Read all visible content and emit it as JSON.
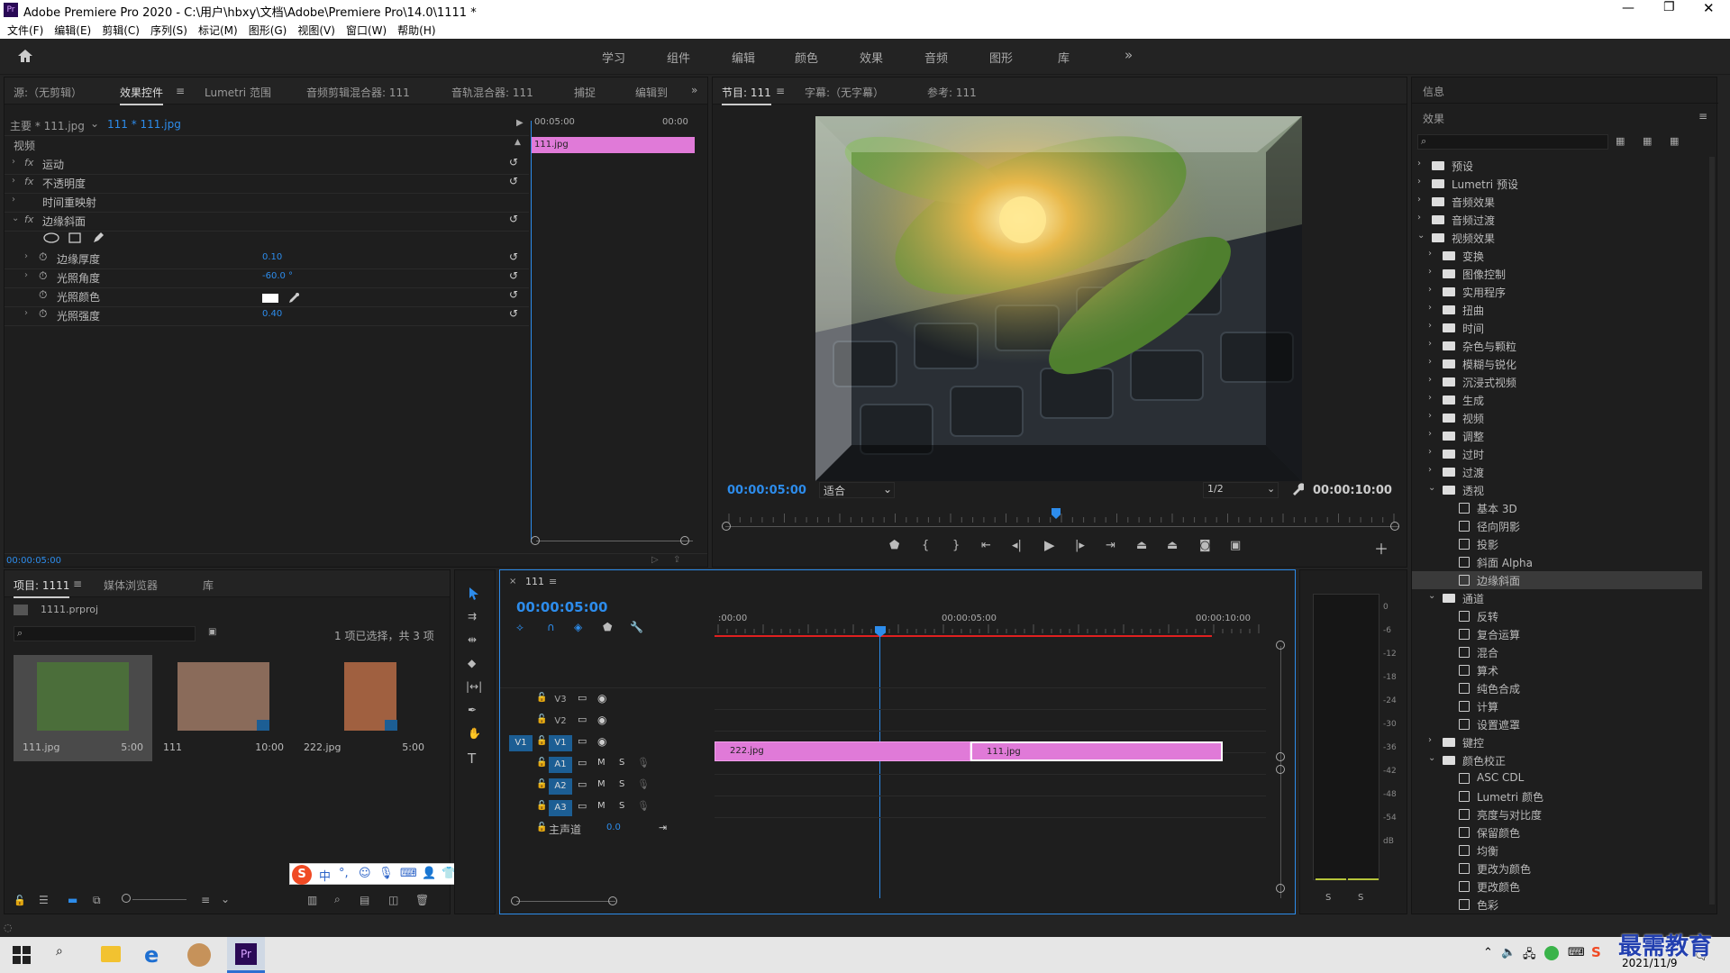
{
  "window": {
    "title": "Adobe Premiere Pro 2020 - C:\\用户\\hbxy\\文档\\Adobe\\Premiere Pro\\14.0\\1111 *"
  },
  "menu": [
    "文件(F)",
    "编辑(E)",
    "剪辑(C)",
    "序列(S)",
    "标记(M)",
    "图形(G)",
    "视图(V)",
    "窗口(W)",
    "帮助(H)"
  ],
  "workspaces": [
    "学习",
    "组件",
    "编辑",
    "颜色",
    "效果",
    "音频",
    "图形",
    "库"
  ],
  "source_panel": {
    "tabs": [
      "源:（无剪辑）",
      "效果控件",
      "Lumetri 范围",
      "音频剪辑混合器: 111",
      "音轨混合器: 111",
      "捕捉",
      "编辑到"
    ],
    "master": "主要 * 111.jpg",
    "clip": "111 * 111.jpg",
    "ruler_start": "00:05:00",
    "ruler_end": "00:00",
    "clip_bar": "111.jpg",
    "section": "视频",
    "effects": [
      {
        "name": "运动",
        "fx": "fx"
      },
      {
        "name": "不透明度",
        "fx": "fx"
      },
      {
        "name": "时间重映射",
        "fx": ""
      },
      {
        "name": "边缘斜面",
        "fx": "fx"
      }
    ],
    "params": [
      {
        "name": "边缘厚度",
        "value": "0.10"
      },
      {
        "name": "光照角度",
        "value": "-60.0 °"
      },
      {
        "name": "光照颜色",
        "value": ""
      },
      {
        "name": "光照强度",
        "value": "0.40"
      }
    ],
    "timecode": "00:00:05:00"
  },
  "program_panel": {
    "tabs": [
      "节目: 111",
      "字幕:（无字幕）",
      "参考: 111"
    ],
    "timecode_left": "00:00:05:00",
    "fit": "适合",
    "resolution": "1/2",
    "timecode_right": "00:00:10:00"
  },
  "right_panel": {
    "info_tab": "信息",
    "effects_tab": "效果",
    "tree": [
      {
        "label": "预设",
        "depth": 0,
        "type": "folder",
        "exp": false
      },
      {
        "label": "Lumetri 预设",
        "depth": 0,
        "type": "folder",
        "exp": false
      },
      {
        "label": "音频效果",
        "depth": 0,
        "type": "folder",
        "exp": false
      },
      {
        "label": "音频过渡",
        "depth": 0,
        "type": "folder",
        "exp": false
      },
      {
        "label": "视频效果",
        "depth": 0,
        "type": "folder",
        "exp": true
      },
      {
        "label": "变换",
        "depth": 1,
        "type": "folder",
        "exp": false
      },
      {
        "label": "图像控制",
        "depth": 1,
        "type": "folder",
        "exp": false
      },
      {
        "label": "实用程序",
        "depth": 1,
        "type": "folder",
        "exp": false
      },
      {
        "label": "扭曲",
        "depth": 1,
        "type": "folder",
        "exp": false
      },
      {
        "label": "时间",
        "depth": 1,
        "type": "folder",
        "exp": false
      },
      {
        "label": "杂色与颗粒",
        "depth": 1,
        "type": "folder",
        "exp": false
      },
      {
        "label": "模糊与锐化",
        "depth": 1,
        "type": "folder",
        "exp": false
      },
      {
        "label": "沉浸式视频",
        "depth": 1,
        "type": "folder",
        "exp": false
      },
      {
        "label": "生成",
        "depth": 1,
        "type": "folder",
        "exp": false
      },
      {
        "label": "视频",
        "depth": 1,
        "type": "folder",
        "exp": false
      },
      {
        "label": "调整",
        "depth": 1,
        "type": "folder",
        "exp": false
      },
      {
        "label": "过时",
        "depth": 1,
        "type": "folder",
        "exp": false
      },
      {
        "label": "过渡",
        "depth": 1,
        "type": "folder",
        "exp": false
      },
      {
        "label": "透视",
        "depth": 1,
        "type": "folder",
        "exp": true
      },
      {
        "label": "基本 3D",
        "depth": 2,
        "type": "fx"
      },
      {
        "label": "径向阴影",
        "depth": 2,
        "type": "fx"
      },
      {
        "label": "投影",
        "depth": 2,
        "type": "fx"
      },
      {
        "label": "斜面 Alpha",
        "depth": 2,
        "type": "fx"
      },
      {
        "label": "边缘斜面",
        "depth": 2,
        "type": "fx",
        "selected": true
      },
      {
        "label": "通道",
        "depth": 1,
        "type": "folder",
        "exp": true
      },
      {
        "label": "反转",
        "depth": 2,
        "type": "fx"
      },
      {
        "label": "复合运算",
        "depth": 2,
        "type": "fx"
      },
      {
        "label": "混合",
        "depth": 2,
        "type": "fx"
      },
      {
        "label": "算术",
        "depth": 2,
        "type": "fx"
      },
      {
        "label": "纯色合成",
        "depth": 2,
        "type": "fx"
      },
      {
        "label": "计算",
        "depth": 2,
        "type": "fx"
      },
      {
        "label": "设置遮罩",
        "depth": 2,
        "type": "fx"
      },
      {
        "label": "键控",
        "depth": 1,
        "type": "folder",
        "exp": false
      },
      {
        "label": "颜色校正",
        "depth": 1,
        "type": "folder",
        "exp": true
      },
      {
        "label": "ASC CDL",
        "depth": 2,
        "type": "fx"
      },
      {
        "label": "Lumetri 颜色",
        "depth": 2,
        "type": "fx"
      },
      {
        "label": "亮度与对比度",
        "depth": 2,
        "type": "fx"
      },
      {
        "label": "保留颜色",
        "depth": 2,
        "type": "fx"
      },
      {
        "label": "均衡",
        "depth": 2,
        "type": "fx"
      },
      {
        "label": "更改为颜色",
        "depth": 2,
        "type": "fx"
      },
      {
        "label": "更改颜色",
        "depth": 2,
        "type": "fx"
      },
      {
        "label": "色彩",
        "depth": 2,
        "type": "fx"
      }
    ]
  },
  "project_panel": {
    "tabs": [
      "项目: 1111",
      "媒体浏览器",
      "库"
    ],
    "file": "1111.prproj",
    "selection": "1 项已选择，共 3 项",
    "items": [
      {
        "name": "111.jpg",
        "dur": "5:00"
      },
      {
        "name": "111",
        "dur": "10:00"
      },
      {
        "name": "222.jpg",
        "dur": "5:00"
      }
    ]
  },
  "timeline": {
    "tab": "111",
    "timecode": "00:00:05:00",
    "ruler": [
      ":00:00",
      "00:00:05:00",
      "00:00:10:00"
    ],
    "video_tracks": [
      "V3",
      "V2",
      "V1"
    ],
    "audio_tracks": [
      "A1",
      "A2",
      "A3"
    ],
    "master": "主声道",
    "master_val": "0.0",
    "clips": [
      "222.jpg",
      "111.jpg"
    ],
    "source_label": "V1",
    "m": "M",
    "s": "S"
  },
  "meter": {
    "scale": [
      "0",
      "-6",
      "-12",
      "-18",
      "-24",
      "-30",
      "-36",
      "-42",
      "-48",
      "-54",
      "dB"
    ],
    "s": "S"
  },
  "taskbar": {
    "date": "2021/11/9"
  },
  "watermark": "最需教育",
  "ime": [
    "中",
    "°,",
    "☺",
    "⌨"
  ],
  "colors": {
    "accent": "#2d8ceb",
    "clip": "#e07ad8",
    "bg": "#1e1e1e"
  }
}
